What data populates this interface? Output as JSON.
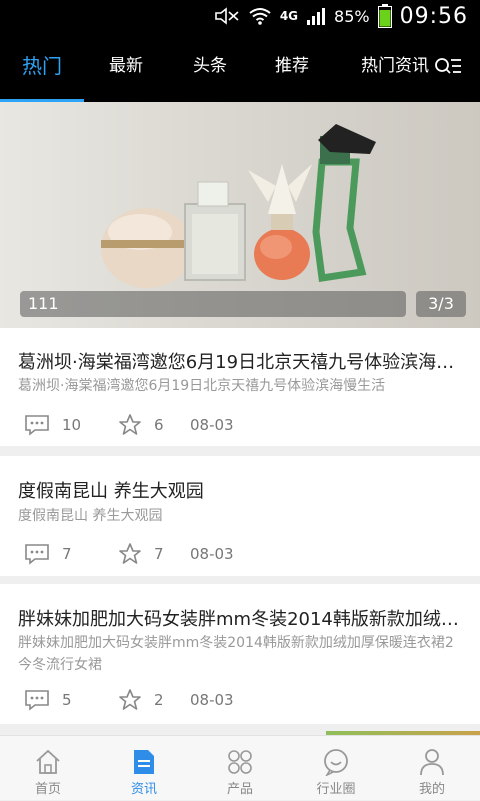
{
  "status_bar": {
    "network": "4G",
    "battery": "85%",
    "time": "09:56"
  },
  "tabs": [
    {
      "label": "热门",
      "active": true
    },
    {
      "label": "最新",
      "active": false
    },
    {
      "label": "头条",
      "active": false
    },
    {
      "label": "推荐",
      "active": false
    },
    {
      "label": "热门资讯",
      "active": false
    }
  ],
  "banner": {
    "caption": "111",
    "counter": "3/3"
  },
  "articles": [
    {
      "title": "葛洲坝·海棠福湾邀您6月19日北京天禧九号体验滨海慢...",
      "summary": "葛洲坝·海棠福湾邀您6月19日北京天禧九号体验滨海慢生活",
      "comments": "10",
      "favorites": "6",
      "date": "08-03"
    },
    {
      "title": "度假南昆山 养生大观园",
      "summary": "度假南昆山 养生大观园",
      "comments": "7",
      "favorites": "7",
      "date": "08-03"
    },
    {
      "title": "胖妹妹加肥加大码女装胖mm冬装2014韩版新款加绒加...",
      "summary": "胖妹妹加肥加大码女装胖mm冬装2014韩版新款加绒加厚保暖连衣裙2今冬流行女裙",
      "comments": "5",
      "favorites": "2",
      "date": "08-03"
    }
  ],
  "bottom_nav": [
    {
      "label": "首页",
      "icon": "home-icon",
      "active": false
    },
    {
      "label": "资讯",
      "icon": "news-icon",
      "active": true
    },
    {
      "label": "产品",
      "icon": "products-icon",
      "active": false
    },
    {
      "label": "行业圈",
      "icon": "chat-icon",
      "active": false
    },
    {
      "label": "我的",
      "icon": "user-icon",
      "active": false
    }
  ],
  "colors": {
    "accent": "#2fa3f3",
    "nav_active": "#2f8de8",
    "header_bg": "#000000"
  }
}
